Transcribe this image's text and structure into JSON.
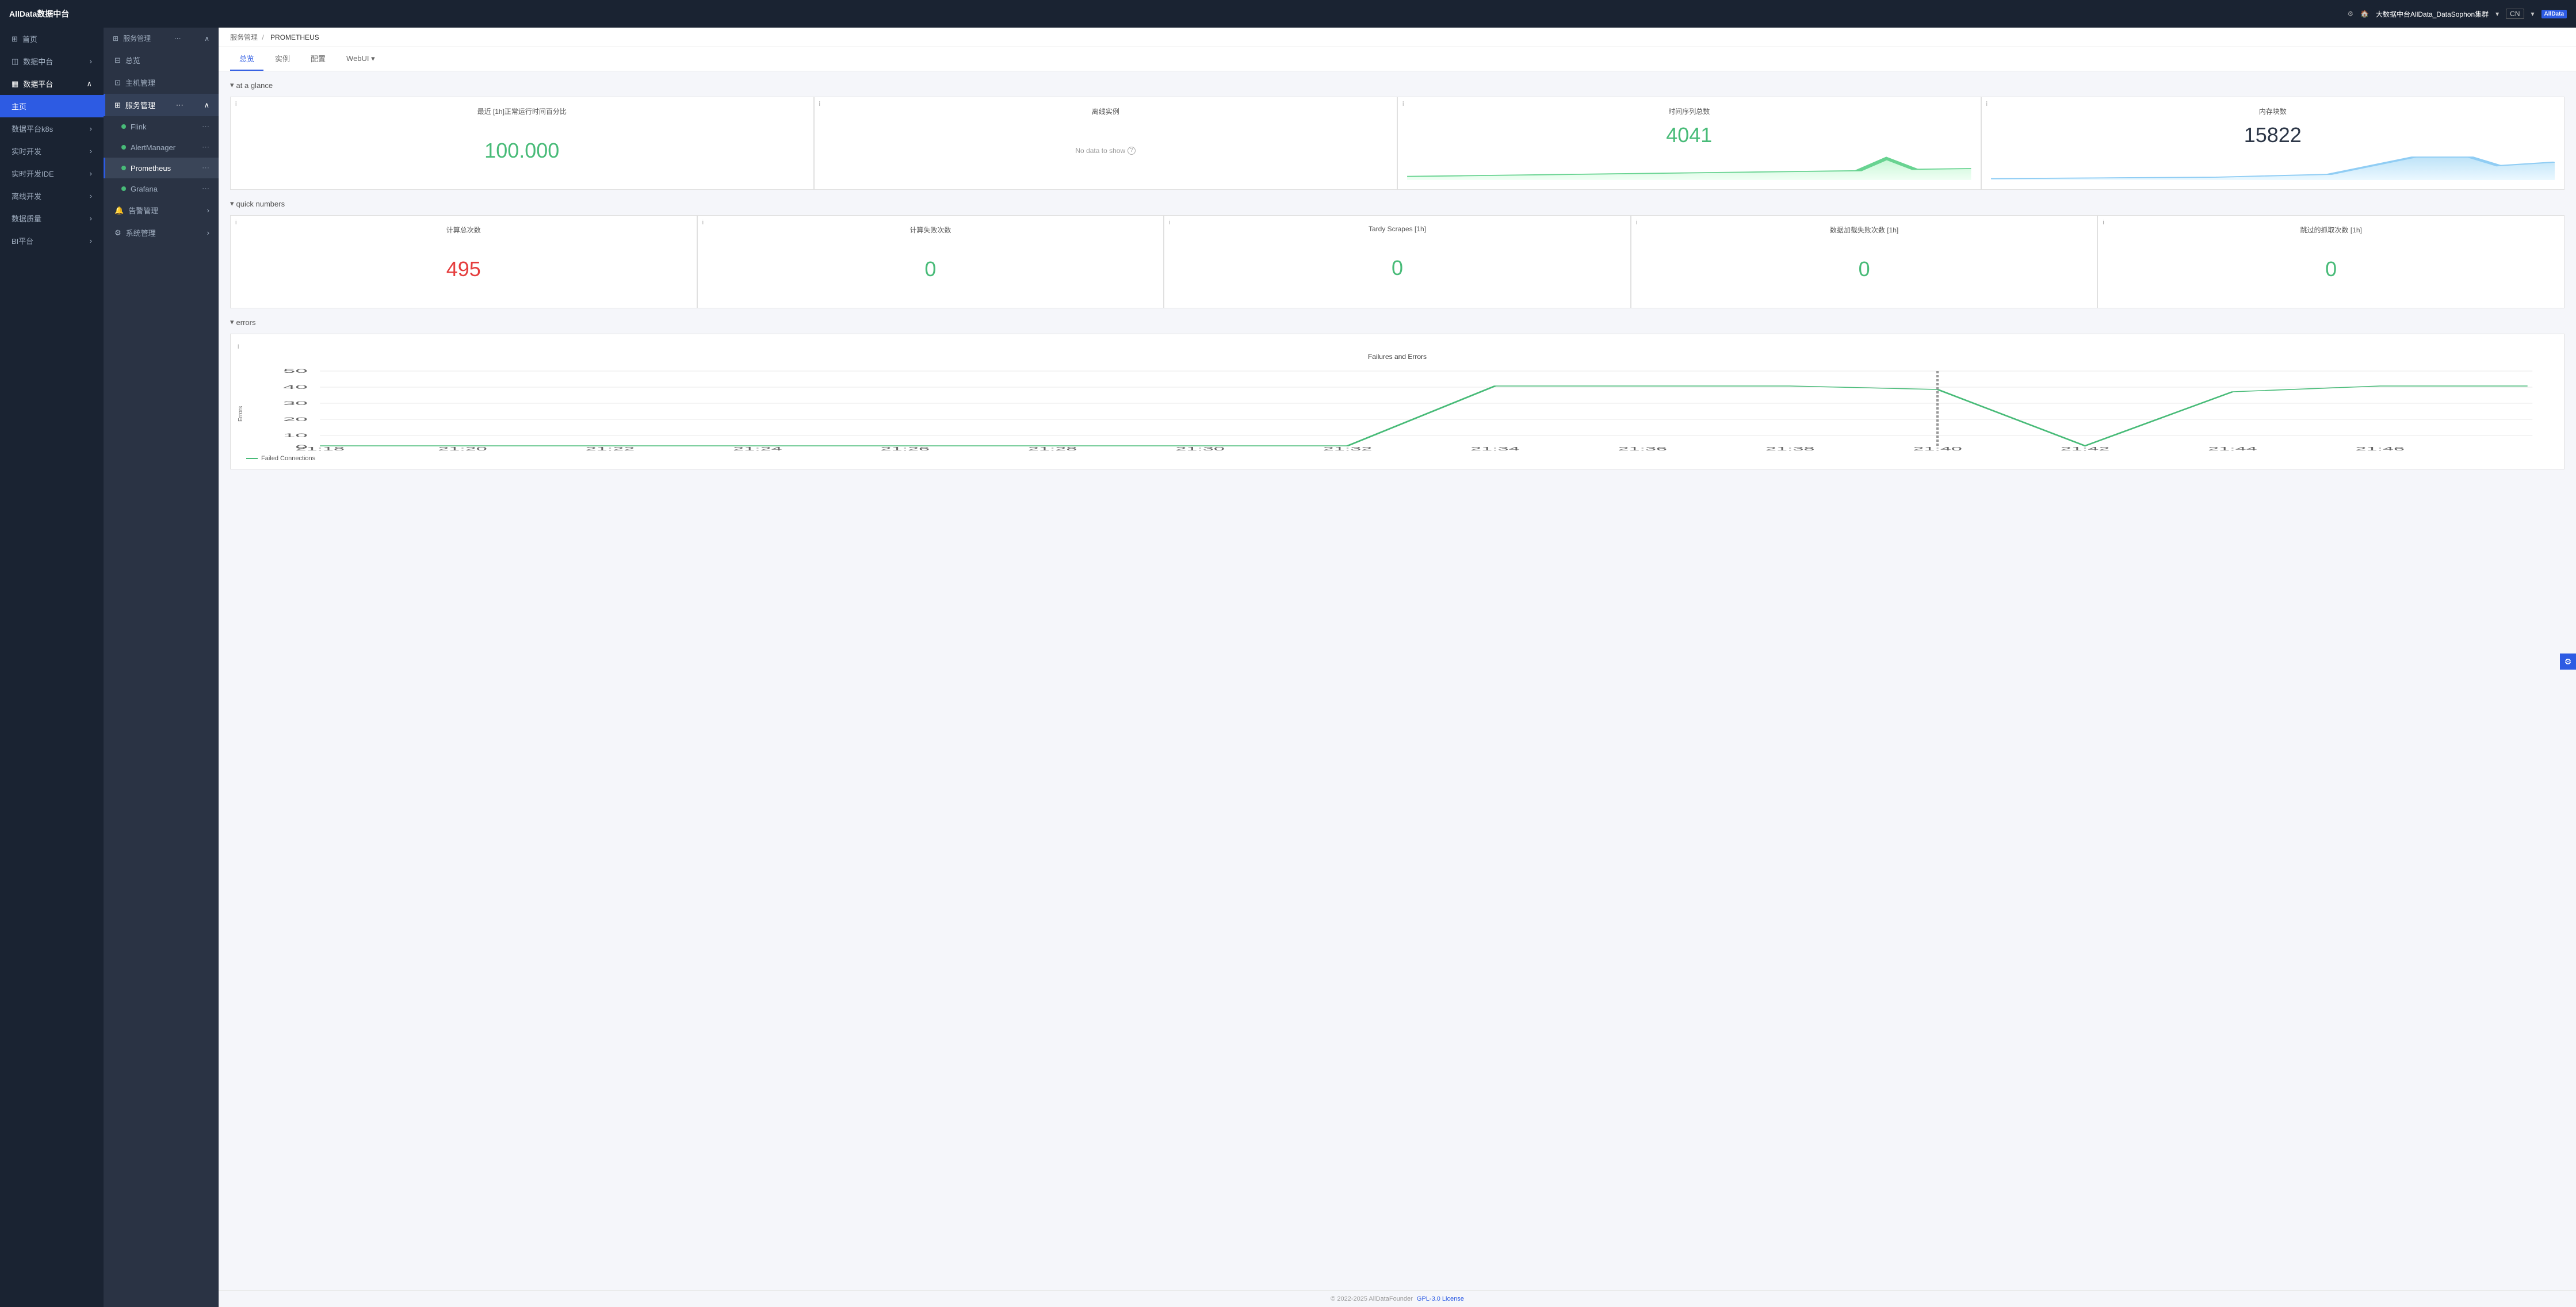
{
  "topbar": {
    "title": "AllData数据中台",
    "settings_icon": "⚙",
    "home_icon": "🏠",
    "cluster_label": "大数据中台AllData_DataSophon集群",
    "lang": "CN",
    "logo_text": "AllData"
  },
  "left_sidebar": {
    "items": [
      {
        "id": "home",
        "label": "首页"
      },
      {
        "id": "data-center",
        "label": "数据中台",
        "has_arrow": true
      },
      {
        "id": "data-platform",
        "label": "数据平台",
        "has_arrow": true,
        "expanded": true
      },
      {
        "id": "main-page",
        "label": "主页",
        "active": true
      },
      {
        "id": "data-platform-k8s",
        "label": "数据平台k8s",
        "has_arrow": true
      },
      {
        "id": "realtime-dev",
        "label": "实时开发",
        "has_arrow": true
      },
      {
        "id": "realtime-ide",
        "label": "实时开发IDE",
        "has_arrow": true
      },
      {
        "id": "offline-dev",
        "label": "离线开发",
        "has_arrow": true
      },
      {
        "id": "data-quality",
        "label": "数据质量",
        "has_arrow": true
      },
      {
        "id": "bi-platform",
        "label": "BI平台",
        "has_arrow": true
      }
    ]
  },
  "second_sidebar": {
    "header": "服务管理",
    "items": [
      {
        "id": "overview",
        "label": "总览"
      },
      {
        "id": "host-mgmt",
        "label": "主机管理"
      },
      {
        "id": "service-mgmt",
        "label": "服务管理",
        "active": true,
        "expanded": true
      },
      {
        "id": "flink",
        "label": "Flink",
        "dot": "green"
      },
      {
        "id": "alert-manager",
        "label": "AlertManager",
        "dot": "green"
      },
      {
        "id": "prometheus",
        "label": "Prometheus",
        "dot": "green",
        "selected": true
      },
      {
        "id": "grafana",
        "label": "Grafana",
        "dot": "green"
      },
      {
        "id": "alert-mgmt",
        "label": "告警管理",
        "has_arrow": true
      },
      {
        "id": "sys-mgmt",
        "label": "系统管理",
        "has_arrow": true
      }
    ]
  },
  "breadcrumb": {
    "path": "服务管理",
    "separator": "/",
    "current": "PROMETHEUS"
  },
  "tabs": [
    {
      "id": "overview",
      "label": "总览",
      "active": true
    },
    {
      "id": "instance",
      "label": "实例"
    },
    {
      "id": "config",
      "label": "配置"
    },
    {
      "id": "webui",
      "label": "WebUI",
      "has_arrow": true
    }
  ],
  "at_a_glance": {
    "section_title": "at a glance",
    "cards": [
      {
        "id": "uptime",
        "title": "最近 [1h]正常运行时间百分比",
        "value": "100.000",
        "value_color": "green",
        "has_info": true
      },
      {
        "id": "offline-instances",
        "title": "离线实例",
        "value": null,
        "no_data": "No data to show",
        "has_info": true
      },
      {
        "id": "time-series",
        "title": "时间序列总数",
        "value": "4041",
        "value_color": "green",
        "has_chart": true,
        "has_info": true
      },
      {
        "id": "memory-blocks",
        "title": "内存块数",
        "value": "15822",
        "value_color": "dark",
        "has_chart": true,
        "has_info": true
      }
    ]
  },
  "quick_numbers": {
    "section_title": "quick numbers",
    "cards": [
      {
        "id": "total-scrapes",
        "title": "计算总次数",
        "value": "495",
        "value_color": "red",
        "has_info": true
      },
      {
        "id": "failed-scrapes",
        "title": "计算失败次数",
        "value": "0",
        "value_color": "green",
        "has_info": true
      },
      {
        "id": "tardy-scrapes",
        "title": "Tardy Scrapes [1h]",
        "value": "0",
        "value_color": "green",
        "has_info": true
      },
      {
        "id": "load-fail",
        "title": "数据加载失败次数 [1h]",
        "value": "0",
        "value_color": "green",
        "has_info": true
      },
      {
        "id": "skipped-scrapes",
        "title": "跳过的抓取次数 [1h]",
        "value": "0",
        "value_color": "green",
        "has_info": true
      }
    ]
  },
  "errors": {
    "section_title": "errors",
    "chart_title": "Failures and Errors",
    "y_label": "Errors",
    "x_ticks": [
      "21:18",
      "21:20",
      "21:22",
      "21:24",
      "21:26",
      "21:28",
      "21:30",
      "21:32",
      "21:34",
      "21:36",
      "21:38",
      "21:40",
      "21:42",
      "21:44",
      "21:46"
    ],
    "y_ticks": [
      "0",
      "10",
      "20",
      "30",
      "40",
      "50"
    ],
    "legend": "Failed Connections",
    "data_points": [
      0,
      0,
      0,
      0,
      0,
      0,
      0,
      0,
      40,
      40,
      40,
      38,
      0,
      35,
      38,
      40
    ]
  },
  "footer": {
    "copyright": "© 2022-2025 AllDataFounder",
    "license_label": "GPL-3.0 License",
    "license_url": "#"
  }
}
